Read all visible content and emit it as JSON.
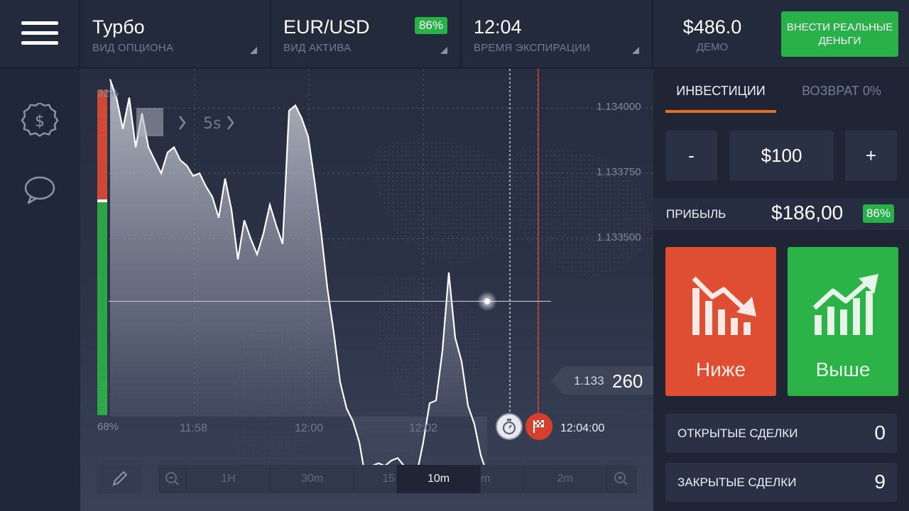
{
  "header": {
    "option": {
      "value": "Турбо",
      "label": "ВИД ОПЦИОНА"
    },
    "asset": {
      "value": "EUR/USD",
      "label": "ВИД АКТИВА",
      "payout_badge": "86%"
    },
    "expiration": {
      "value": "12:04",
      "label": "ВРЕМЯ ЭКСПИРАЦИИ"
    },
    "balance": {
      "value": "$486.0",
      "label": "ДЕМО"
    },
    "deposit_button": "ВНЕСТИ РЕАЛЬНЫЕ ДЕНЬГИ"
  },
  "sidebar": {
    "icons": [
      "dollar-icon",
      "chat-bubble-icon"
    ]
  },
  "chart": {
    "sentiment": {
      "down_label": "НИЖЕ",
      "up_label": "ВЫШЕ",
      "down_pct": "32%",
      "up_pct": "68%"
    },
    "y_ticks": [
      "1.134000",
      "1.133750",
      "1.133500"
    ],
    "x_ticks": [
      "11:58",
      "12:00",
      "12:02"
    ],
    "current_price_small": "1.133",
    "current_price_big": "260",
    "expiry_time": "12:04:00",
    "interval_label": "5s",
    "timeframes": [
      "1H",
      "30m",
      "15",
      "10m",
      "m",
      "2m"
    ],
    "active_timeframe": "10m",
    "colors": {
      "down": "#df4d33",
      "up": "#2bb347"
    }
  },
  "chart_data": {
    "type": "area",
    "x": [
      "11:57:00",
      "11:57:06",
      "11:57:12",
      "11:57:18",
      "11:57:24",
      "11:57:30",
      "11:57:36",
      "11:57:42",
      "11:57:48",
      "11:57:54",
      "11:58:00",
      "11:58:06",
      "11:58:12",
      "11:58:18",
      "11:58:24",
      "11:58:30",
      "11:58:36",
      "11:58:42",
      "11:58:48",
      "11:58:54",
      "11:59:00",
      "11:59:06",
      "11:59:12",
      "11:59:18",
      "11:59:24",
      "11:59:30",
      "11:59:36",
      "11:59:42",
      "11:59:48",
      "11:59:54",
      "12:00:00",
      "12:00:06",
      "12:00:12",
      "12:00:18",
      "12:00:24",
      "12:00:30",
      "12:00:36",
      "12:00:42",
      "12:00:48",
      "12:00:54",
      "12:01:00",
      "12:01:06",
      "12:01:12",
      "12:01:18",
      "12:01:24",
      "12:01:30",
      "12:01:36",
      "12:01:42",
      "12:01:48",
      "12:01:54",
      "12:02:00",
      "12:02:06",
      "12:02:12",
      "12:02:18",
      "12:02:24",
      "12:02:30",
      "12:02:36",
      "12:02:42",
      "12:02:48",
      "12:02:54"
    ],
    "values": [
      1.13411,
      1.13404,
      1.13392,
      1.13404,
      1.13385,
      1.13398,
      1.13385,
      1.1338,
      1.13375,
      1.13383,
      1.13385,
      1.1338,
      1.13378,
      1.13374,
      1.13375,
      1.1337,
      1.13366,
      1.13358,
      1.13373,
      1.13361,
      1.13342,
      1.13357,
      1.1335,
      1.13344,
      1.13352,
      1.13363,
      1.13355,
      1.13348,
      1.13399,
      1.13401,
      1.13396,
      1.13389,
      1.13372,
      1.13353,
      1.13331,
      1.13314,
      1.13295,
      1.13285,
      1.1328,
      1.13272,
      1.13258,
      1.13263,
      1.13264,
      1.13263,
      1.13265,
      1.13266,
      1.13263,
      1.13258,
      1.1326,
      1.13272,
      1.13287,
      1.13288,
      1.13307,
      1.13337,
      1.13312,
      1.13303,
      1.13286,
      1.13279,
      1.13267,
      1.1326
    ],
    "xlabel": "",
    "ylabel": "",
    "ylim": [
      1.1329,
      1.13415
    ],
    "y_ticks": [
      1.134,
      1.13375,
      1.1335
    ],
    "current": 1.13326
  },
  "panel": {
    "tabs": [
      "ИНВЕСТИЦИИ",
      "ВОЗВРАТ 0%"
    ],
    "minus": "-",
    "amount": "$100",
    "plus": "+",
    "profit_label": "ПРИБЫЛЬ",
    "profit_value": "$186,00",
    "profit_pct": "86%",
    "down_button": "Ниже",
    "up_button": "Выше",
    "open_deals_label": "ОТКРЫТЫЕ СДЕЛКИ",
    "open_deals_count": "0",
    "closed_deals_label": "ЗАКРЫТЫЕ СДЕЛКИ",
    "closed_deals_count": "9"
  }
}
